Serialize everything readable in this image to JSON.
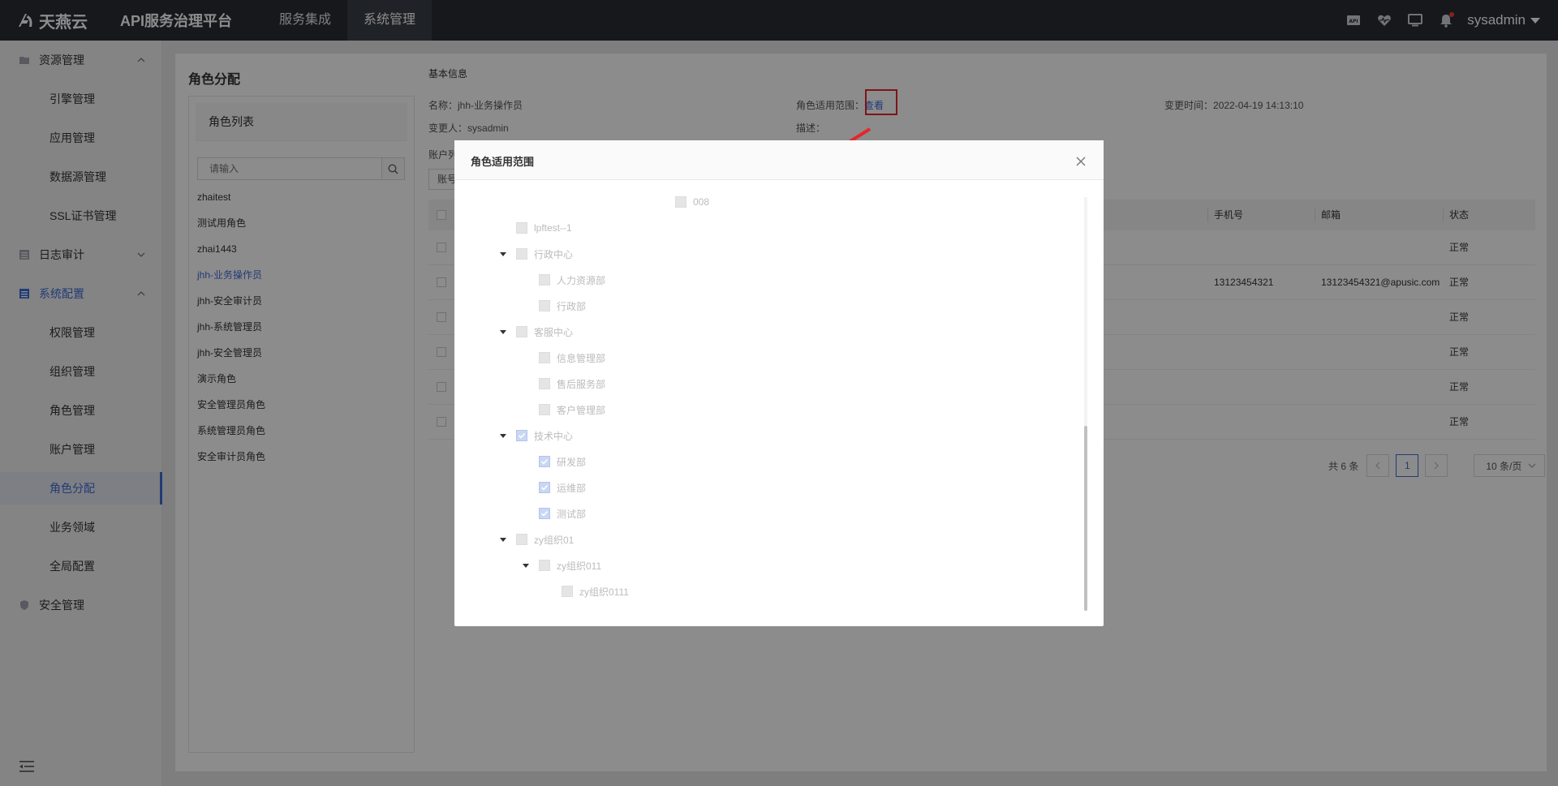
{
  "topbar": {
    "brand": "天燕云",
    "platform": "API服务治理平台",
    "nav": [
      "服务集成",
      "系统管理"
    ],
    "active_nav": "系统管理",
    "user": "sysadmin",
    "icons": [
      "api-icon",
      "heartbeat-icon",
      "monitor-icon",
      "bell-icon"
    ]
  },
  "sidebar": {
    "groups": [
      {
        "label": "资源管理",
        "items": [
          "引擎管理",
          "应用管理",
          "数据源管理",
          "SSL证书管理"
        ],
        "expanded": true
      },
      {
        "label": "日志审计",
        "items": [],
        "expanded": false
      },
      {
        "label": "系统配置",
        "items": [
          "权限管理",
          "组织管理",
          "角色管理",
          "账户管理",
          "角色分配",
          "业务领域",
          "全局配置"
        ],
        "expanded": true
      },
      {
        "label": "安全管理",
        "items": [],
        "expanded": false
      }
    ],
    "active_item": "角色分配"
  },
  "page": {
    "title": "角色分配",
    "role_list_title": "角色列表",
    "search_placeholder": "请输入",
    "roles": [
      "zhaitest",
      "测试用角色",
      "zhai1443",
      "jhh-业务操作员",
      "jhh-安全审计员",
      "jhh-系统管理员",
      "jhh-安全管理员",
      "演示角色",
      "安全管理员角色",
      "系统管理员角色",
      "安全审计员角色"
    ],
    "active_role": "jhh-业务操作员",
    "basic_info_title": "基本信息",
    "name_label": "名称：",
    "name_value": "jhh-业务操作员",
    "scope_label": "角色适用范围：",
    "scope_link": "查看",
    "changed_time_label": "变更时间：",
    "changed_time_value": "2022-04-19 14:13:10",
    "changer_label": "变更人：",
    "changer_value": "sysadmin",
    "desc_label": "描述：",
    "account_list_label": "账户列",
    "account_btn": "账号",
    "table": {
      "headers": [
        "手机号",
        "邮箱",
        "状态"
      ],
      "rows": [
        {
          "phone": "",
          "email": "",
          "status": "正常"
        },
        {
          "phone": "13123454321",
          "email": "13123454321@apusic.com",
          "status": "正常"
        },
        {
          "phone": "",
          "email": "",
          "status": "正常"
        },
        {
          "phone": "",
          "email": "",
          "status": "正常"
        },
        {
          "phone": "",
          "email": "",
          "status": "正常"
        },
        {
          "phone": "",
          "email": "",
          "status": "正常"
        }
      ]
    },
    "pager": {
      "total": "共 6 条",
      "current": "1",
      "page_size": "10 条/页"
    }
  },
  "modal": {
    "title": "角色适用范围",
    "nodes": [
      {
        "label": "008",
        "level": 4,
        "expandable": false,
        "checked": false
      },
      {
        "label": "lpftest--1",
        "level": 1,
        "expandable": false,
        "checked": false
      },
      {
        "label": "行政中心",
        "level": 1,
        "expandable": true,
        "checked": false
      },
      {
        "label": "人力资源部",
        "level": 2,
        "expandable": false,
        "checked": false
      },
      {
        "label": "行政部",
        "level": 2,
        "expandable": false,
        "checked": false
      },
      {
        "label": "客服中心",
        "level": 1,
        "expandable": true,
        "checked": false
      },
      {
        "label": "信息管理部",
        "level": 2,
        "expandable": false,
        "checked": false
      },
      {
        "label": "售后服务部",
        "level": 2,
        "expandable": false,
        "checked": false
      },
      {
        "label": "客户管理部",
        "level": 2,
        "expandable": false,
        "checked": false
      },
      {
        "label": "技术中心",
        "level": 1,
        "expandable": true,
        "checked": true
      },
      {
        "label": "研发部",
        "level": 2,
        "expandable": false,
        "checked": true
      },
      {
        "label": "运维部",
        "level": 2,
        "expandable": false,
        "checked": true
      },
      {
        "label": "测试部",
        "level": 2,
        "expandable": false,
        "checked": true
      },
      {
        "label": "zy组织01",
        "level": 1,
        "expandable": true,
        "checked": false
      },
      {
        "label": "zy组织011",
        "level": 2,
        "expandable": true,
        "checked": false
      },
      {
        "label": "zy组织0111",
        "level": 3,
        "expandable": false,
        "checked": false
      }
    ]
  },
  "colors": {
    "accent": "#3e6cd7",
    "topbar": "#2a2d33",
    "highlight_box": "#e4262b"
  }
}
